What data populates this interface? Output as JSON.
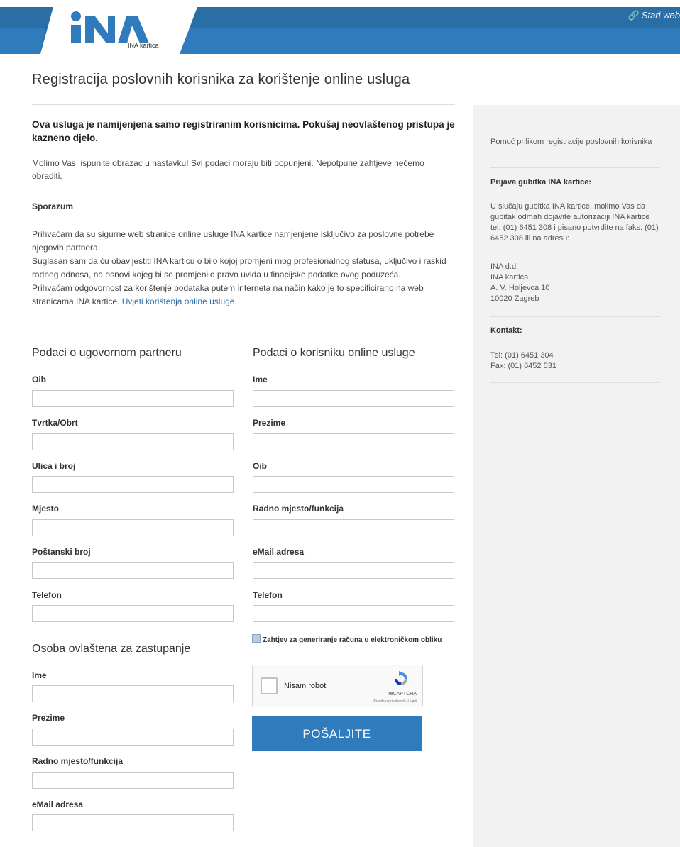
{
  "header": {
    "logo_text": "INA",
    "logo_sub": "INA kartica",
    "old_web_link": "Stari web",
    "colors": {
      "bar_dark": "#2a6ea6",
      "bar_light": "#2f7bbb"
    }
  },
  "page": {
    "title": "Registracija poslovnih korisnika za korištenje online usluga",
    "intro_bold": "Ova usluga je namijenjena samo registriranim korisnicima. Pokušaj neovlaštenog pristupa je kazneno djelo.",
    "intro_text": "Molimo Vas, ispunite obrazac u nastavku! Svi podaci moraju biti popunjeni. Nepotpune zahtjeve nećemo obraditi.",
    "agreement_title": "Sporazum",
    "agreement_p1": "Prihvaćam da su sigurne web stranice online usluge INA kartice namjenjene isključivo za poslovne potrebe njegovih partnera.",
    "agreement_p2": "Suglasan sam da ću obavijestiti INA karticu o bilo kojoj promjeni mog profesionalnog statusa, uključivo i raskid radnog odnosa, na osnovi kojeg bi se promjenilo pravo uvida u finacijske podatke ovog poduzeća.",
    "agreement_p3": "Prihvaćam odgovornost za korištenje podataka putem interneta na način kako je to specificirano na web stranicama INA kartice.",
    "terms_link": "Uvjeti korištenja online usluge."
  },
  "form": {
    "partner": {
      "title": "Podaci o ugovornom partneru",
      "fields": [
        {
          "label": "Oib",
          "value": ""
        },
        {
          "label": "Tvrtka/Obrt",
          "value": ""
        },
        {
          "label": "Ulica i broj",
          "value": ""
        },
        {
          "label": "Mjesto",
          "value": ""
        },
        {
          "label": "Poštanski broj",
          "value": ""
        },
        {
          "label": "Telefon",
          "value": ""
        }
      ]
    },
    "user": {
      "title": "Podaci o korisniku online usluge",
      "fields": [
        {
          "label": "Ime",
          "value": ""
        },
        {
          "label": "Prezime",
          "value": ""
        },
        {
          "label": "Oib",
          "value": ""
        },
        {
          "label": "Radno mjesto/funkcija",
          "value": ""
        },
        {
          "label": "eMail adresa",
          "value": ""
        },
        {
          "label": "Telefon",
          "value": ""
        }
      ]
    },
    "representative": {
      "title": "Osoba ovlaštena za zastupanje",
      "fields": [
        {
          "label": "Ime",
          "value": ""
        },
        {
          "label": "Prezime",
          "value": ""
        },
        {
          "label": "Radno mjesto/funkcija",
          "value": ""
        },
        {
          "label": "eMail adresa",
          "value": ""
        }
      ]
    },
    "einvoice_label": "Zahtjev za generiranje računa u elektroničkom obliku",
    "captcha": {
      "label": "Nisam robot",
      "brand": "reCAPTCHA",
      "links": "Pravila o privatnosti - Uvjeti"
    },
    "submit_label": "POŠALJITE"
  },
  "sidebar": {
    "help_text": "Pomoć prilikom registracije poslovnih korisnika",
    "loss_title": "Prijava gubitka INA kartice:",
    "loss_text": "U slučaju gubitka INA kartice, molimo Vas da gubitak odmah dojavite autorizaciji INA kartice tel: (01) 6451 308 i pisano potvrdite na faks: (01) 6452 308 ili na adresu:",
    "address": [
      "INA d.d.",
      "INA kartica",
      "A. V. Holjevca 10",
      "10020 Zagreb"
    ],
    "contact_title": "Kontakt:",
    "contact_tel": "Tel: (01) 6451 304",
    "contact_fax": "Fax: (01) 6452 531"
  }
}
